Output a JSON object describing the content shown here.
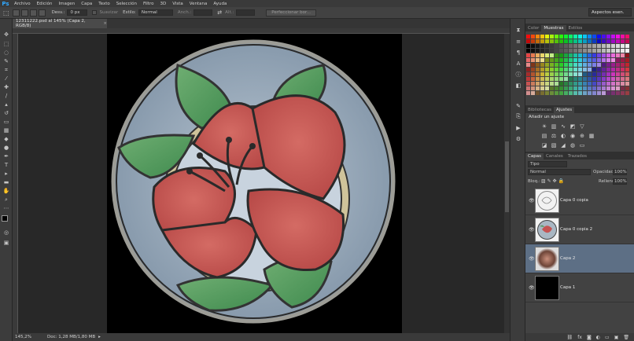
{
  "app": {
    "logo": "Ps",
    "menu": [
      "Archivo",
      "Edición",
      "Imagen",
      "Capa",
      "Texto",
      "Selección",
      "Filtro",
      "3D",
      "Vista",
      "Ventana",
      "Ayuda"
    ],
    "workspace": "Aspectos esen."
  },
  "options": {
    "desv_label": "Desv.:",
    "desv_value": "0 px",
    "suavizar": "Suavizar",
    "estilo_label": "Estilo:",
    "estilo_value": "Normal",
    "anch_label": "Anch.:",
    "alt_label": "Alt.:",
    "refine_button": "Perfeccionar bor..."
  },
  "document": {
    "tab_title": "12311222.psd al 145% (Capa 2, RGB/8)",
    "close": "×",
    "zoom": "145,2%",
    "doc_size": "Doc: 1,28 MB/1,80 MB"
  },
  "panels": {
    "color_tabs": [
      "Color",
      "Muestras",
      "Estilos"
    ],
    "color_active": 1,
    "adj_tabs": [
      "Bibliotecas",
      "Ajustes"
    ],
    "adj_active": 1,
    "adj_title": "Añadir un ajuste",
    "layers_tabs": [
      "Capas",
      "Canales",
      "Trazados"
    ],
    "layers_active": 0,
    "filter_label": "Tipo",
    "blend_mode": "Normal",
    "opacity_label": "Opacidad:",
    "opacity_value": "100%",
    "lock_label": "Bloq.:",
    "fill_label": "Relleno:",
    "fill_value": "100%"
  },
  "layers": [
    {
      "name": "Capa 0 copia",
      "active": false
    },
    {
      "name": "Capa 0 copia 2",
      "active": false
    },
    {
      "name": "Capa 2",
      "active": true
    },
    {
      "name": "Capa 1",
      "active": false
    }
  ],
  "colors": {
    "accent": "#31a8ff",
    "active_layer": "#5d6f85"
  }
}
